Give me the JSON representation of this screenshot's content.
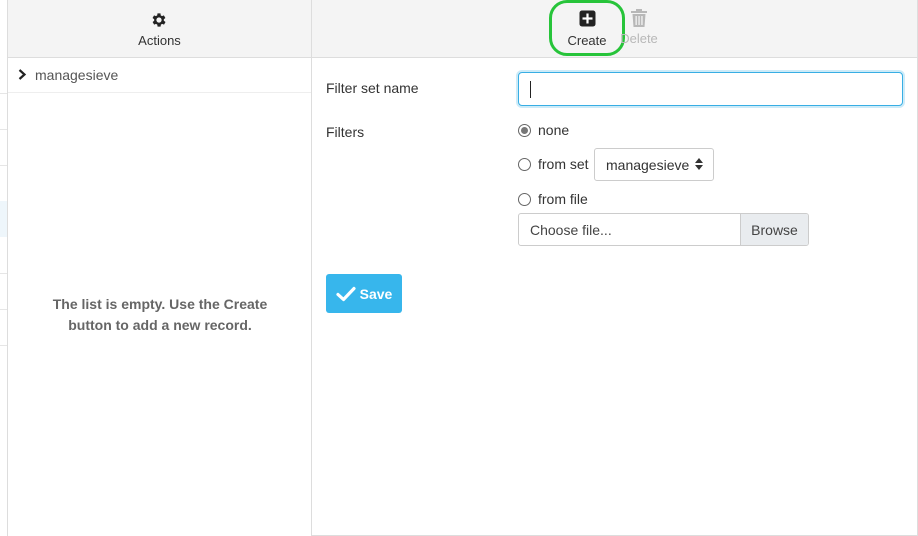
{
  "toolbar": {
    "actions_label": "Actions",
    "create_label": "Create",
    "delete_label": "Delete"
  },
  "filter_sets": {
    "items": [
      {
        "label": "managesieve"
      }
    ],
    "empty_message": "The list is empty. Use the Create button to add a new record."
  },
  "form": {
    "name_label": "Filter set name",
    "name_value": "",
    "filters_label": "Filters",
    "option_none": "none",
    "option_from_set": "from set",
    "option_from_file": "from file",
    "selected_option": "none",
    "from_set_select": "managesieve",
    "file_placeholder": "Choose file...",
    "browse_label": "Browse",
    "save_label": "Save"
  },
  "colors": {
    "accent": "#37b6ec",
    "highlight_ring": "#27c43a",
    "disabled_text": "#b8b8b8"
  },
  "icons": {
    "actions": "gear-icon",
    "create": "plus-square-icon",
    "delete": "trash-icon",
    "expand": "chevron-right-icon",
    "save": "check-icon"
  }
}
